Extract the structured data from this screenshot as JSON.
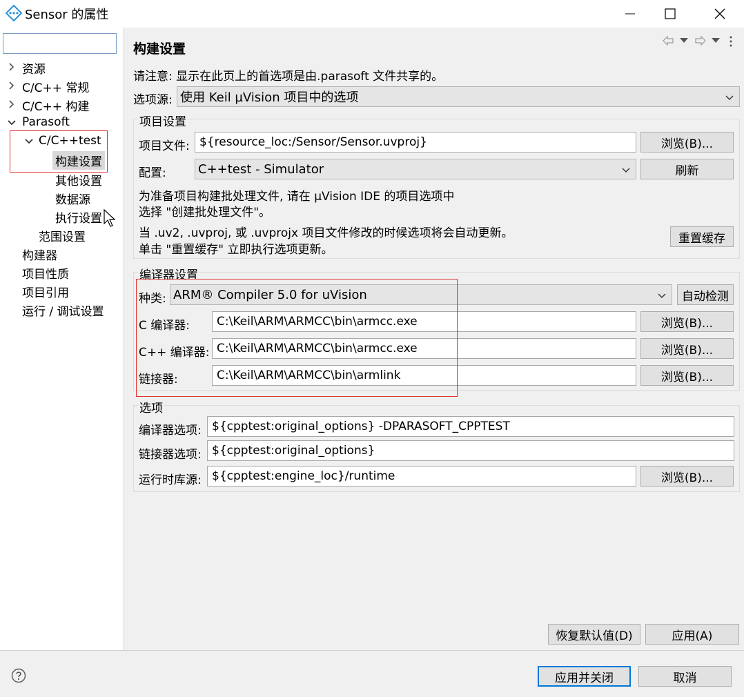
{
  "window": {
    "title": "Sensor 的属性"
  },
  "left": {
    "filter_value": "",
    "tree": [
      {
        "label": "资源"
      },
      {
        "label": "C/C++ 常规"
      },
      {
        "label": "C/C++ 构建"
      },
      {
        "label": "Parasoft"
      },
      {
        "label": "C/C++test"
      },
      {
        "label": "构建设置"
      },
      {
        "label": "其他设置"
      },
      {
        "label": "数据源"
      },
      {
        "label": "执行设置"
      },
      {
        "label": "范围设置"
      },
      {
        "label": "构建器"
      },
      {
        "label": "项目性质"
      },
      {
        "label": "项目引用"
      },
      {
        "label": "运行 / 调试设置"
      }
    ]
  },
  "main": {
    "title": "构建设置",
    "note": "请注意: 显示在此页上的首选项是由.parasoft 文件共享的。",
    "option_source_label": "选项源:",
    "option_source_value": "使用 Keil µVision 项目中的选项",
    "project": {
      "legend": "项目设置",
      "file_label": "项目文件:",
      "file_value": "${resource_loc:/Sensor/Sensor.uvproj}",
      "browse": "浏览(B)...",
      "config_label": "配置:",
      "config_value": "C++test - Simulator",
      "refresh": "刷新",
      "info1": "为准备项目构建批处理文件, 请在 µVision IDE 的项目选项中",
      "info2": "选择 \"创建批处理文件\"。",
      "info3": "当 .uv2, .uvproj, 或 .uvprojx 项目文件修改的时候选项将会自动更新。",
      "info4": "单击 \"重置缓存\" 立即执行选项更新。",
      "reset_cache": "重置缓存"
    },
    "compiler": {
      "legend": "编译器设置",
      "kind_label": "种类:",
      "kind_value": "ARM® Compiler 5.0 for uVision",
      "autodetect": "自动检测",
      "c_label": "C 编译器:",
      "c_value": "C:\\Keil\\ARM\\ARMCC\\bin\\armcc.exe",
      "cpp_label": "C++ 编译器:",
      "cpp_value": "C:\\Keil\\ARM\\ARMCC\\bin\\armcc.exe",
      "linker_label": "链接器:",
      "linker_value": "C:\\Keil\\ARM\\ARMCC\\bin\\armlink",
      "browse": "浏览(B)..."
    },
    "options": {
      "legend": "选项",
      "compiler_opts_label": "编译器选项:",
      "compiler_opts_value": "${cpptest:original_options} -DPARASOFT_CPPTEST",
      "linker_opts_label": "链接器选项:",
      "linker_opts_value": "${cpptest:original_options}",
      "runtime_label": "运行时库源:",
      "runtime_value": "${cpptest:engine_loc}/runtime",
      "browse": "浏览(B)..."
    },
    "restore_defaults": "恢复默认值(D)",
    "apply": "应用(A)"
  },
  "footer": {
    "apply_close": "应用并关闭",
    "cancel": "取消"
  },
  "colors": {
    "accent": "#0078d7",
    "highlight_box": "#e03030"
  }
}
